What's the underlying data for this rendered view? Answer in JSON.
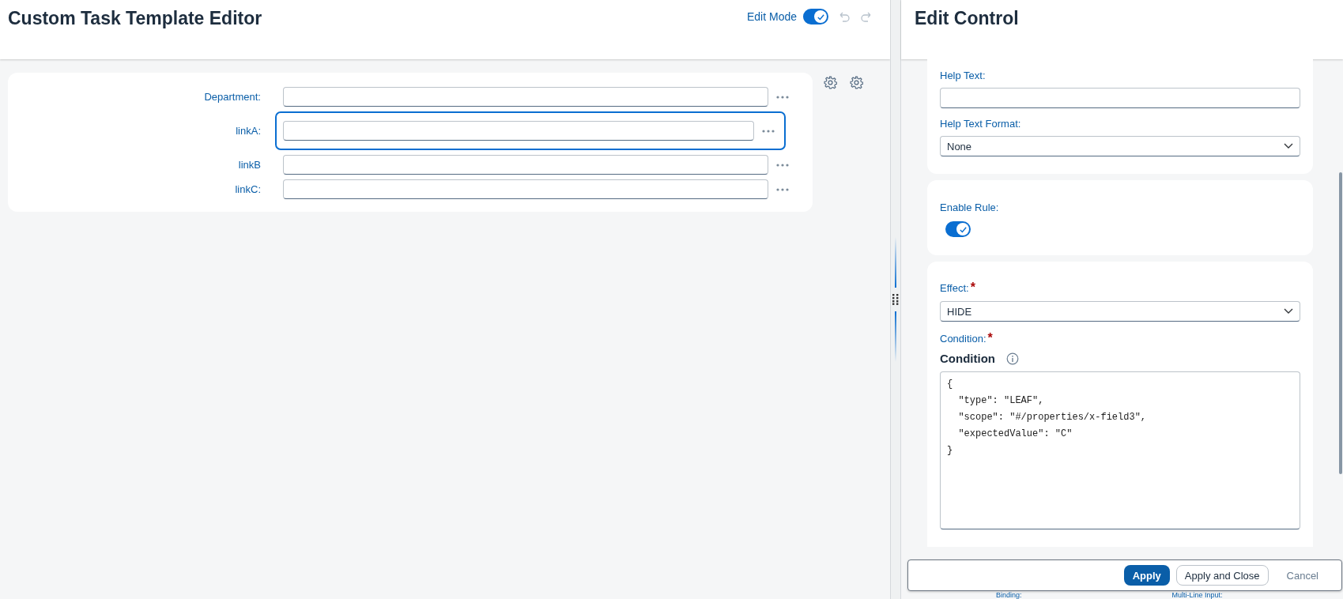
{
  "editor": {
    "title": "Custom Task Template Editor",
    "edit_mode": {
      "label": "Edit Mode",
      "on": true
    }
  },
  "form": {
    "fields": [
      {
        "label": "Department:",
        "selected": false
      },
      {
        "label": "linkA:",
        "selected": true
      },
      {
        "label": "linkB",
        "selected": false
      },
      {
        "label": "linkC:",
        "selected": false
      }
    ]
  },
  "panel": {
    "title": "Edit Control",
    "help_text": {
      "label": "Help Text:"
    },
    "help_text_format": {
      "label": "Help Text Format:",
      "value": "None"
    },
    "enable_rule": {
      "label": "Enable Rule:",
      "on": true
    },
    "effect": {
      "label": "Effect:",
      "required_mark": "*",
      "value": "HIDE"
    },
    "condition": {
      "label": "Condition:",
      "required_mark": "*",
      "heading": "Condition",
      "code": [
        "{",
        "  \"type\": \"LEAF\",",
        "  \"scope\": \"#/properties/x-field3\",",
        "  \"expectedValue\": \"C\"",
        "}"
      ]
    }
  },
  "footer": {
    "buttons": [
      {
        "label": "Apply",
        "kind": "primary"
      },
      {
        "label": "Apply and Close",
        "kind": "secondary"
      },
      {
        "label": "Cancel",
        "kind": "transparent"
      }
    ]
  },
  "behind_labels": [
    "Binding:",
    "Multi-Line Input:"
  ]
}
